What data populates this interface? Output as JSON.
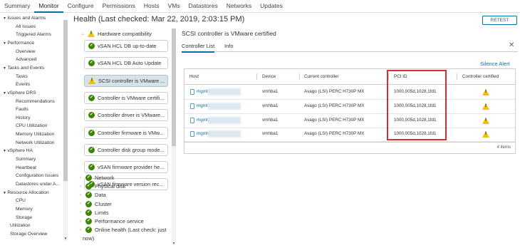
{
  "top_tabs": [
    "Summary",
    "Monitor",
    "Configure",
    "Permissions",
    "Hosts",
    "VMs",
    "Datastores",
    "Networks",
    "Updates"
  ],
  "active_tab": "Monitor",
  "sidebar": {
    "items": [
      {
        "label": "Issues and Alarms",
        "caret": "▼",
        "indent": 0
      },
      {
        "label": "All Issues",
        "caret": "",
        "indent": 1
      },
      {
        "label": "Triggered Alarms",
        "caret": "",
        "indent": 1
      },
      {
        "label": "Performance",
        "caret": "▼",
        "indent": 0
      },
      {
        "label": "Overview",
        "caret": "",
        "indent": 1
      },
      {
        "label": "Advanced",
        "caret": "",
        "indent": 1
      },
      {
        "label": "Tasks and Events",
        "caret": "▼",
        "indent": 0
      },
      {
        "label": "Tasks",
        "caret": "",
        "indent": 1
      },
      {
        "label": "Events",
        "caret": "",
        "indent": 1
      },
      {
        "label": "vSphere DRS",
        "caret": "▼",
        "indent": 0
      },
      {
        "label": "Recommendations",
        "caret": "",
        "indent": 1
      },
      {
        "label": "Faults",
        "caret": "",
        "indent": 1
      },
      {
        "label": "History",
        "caret": "",
        "indent": 1
      },
      {
        "label": "CPU Utilization",
        "caret": "",
        "indent": 1
      },
      {
        "label": "Memory Utilization",
        "caret": "",
        "indent": 1
      },
      {
        "label": "Network Utilization",
        "caret": "",
        "indent": 1
      },
      {
        "label": "vSphere HA",
        "caret": "▼",
        "indent": 0
      },
      {
        "label": "Summary",
        "caret": "",
        "indent": 1
      },
      {
        "label": "Heartbeat",
        "caret": "",
        "indent": 1
      },
      {
        "label": "Configuration Issues",
        "caret": "",
        "indent": 1
      },
      {
        "label": "Datastores under A...",
        "caret": "",
        "indent": 1
      },
      {
        "label": "Resource Allocation",
        "caret": "▼",
        "indent": 0
      },
      {
        "label": "CPU",
        "caret": "",
        "indent": 1
      },
      {
        "label": "Memory",
        "caret": "",
        "indent": 1
      },
      {
        "label": "Storage",
        "caret": "",
        "indent": 1
      },
      {
        "label": "Utilization",
        "caret": "",
        "indent": 0.5
      },
      {
        "label": "Storage Overview",
        "caret": "",
        "indent": 0.5
      }
    ]
  },
  "health": {
    "title": "Health (Last checked: Mar 22, 2019, 2:03:15 PM)",
    "retest_label": "RETEST",
    "hw_group": "Hardware compatibility",
    "checks": [
      {
        "label": "vSAN HCL DB up-to-date",
        "status": "ok"
      },
      {
        "label": "vSAN HCL DB Auto Update",
        "status": "ok"
      },
      {
        "label": "SCSI controller is VMware ...",
        "status": "warn"
      },
      {
        "label": "Controller is VMware certifi...",
        "status": "ok"
      },
      {
        "label": "Controller driver is VMware...",
        "status": "ok"
      },
      {
        "label": "Controller firmware is VMw...",
        "status": "ok"
      },
      {
        "label": "Controller disk group mode...",
        "status": "ok"
      },
      {
        "label": "vSAN firmware provider he...",
        "status": "ok"
      },
      {
        "label": "vSAN firmware version rec...",
        "status": "ok"
      }
    ],
    "groups": [
      "Network",
      "Physical disk",
      "Data",
      "Cluster",
      "Limits",
      "Performance service",
      "Online health (Last check: just"
    ],
    "groups_tail": "now)"
  },
  "detail": {
    "title": "SCSI controller is VMware certified",
    "tabs": [
      "Controller List",
      "Info"
    ],
    "silence_label": "Silence Alert",
    "columns": [
      "Host",
      "Device",
      "Current controller",
      "PCI ID",
      "Controller certified"
    ],
    "rows": [
      {
        "host": "mgmt3",
        "device": "vmhba1",
        "controller": "Avago (LSI) PERC H730P MX",
        "pci": "1000,005d,1028,1fd1"
      },
      {
        "host": "mgmt1",
        "device": "vmhba1",
        "controller": "Avago (LSI) PERC H730P MX",
        "pci": "1000,005d,1028,1fd1"
      },
      {
        "host": "mgmt2",
        "device": "vmhba1",
        "controller": "Avago (LSI) PERC H730P MX",
        "pci": "1000,005d,1028,1fd1"
      },
      {
        "host": "mgmt4",
        "device": "vmhba1",
        "controller": "Avago (LSI) PERC H730P MX",
        "pci": "1000,005d,1028,1fd1"
      }
    ],
    "items_count": "4 items"
  },
  "colors": {
    "accent": "#0072a3",
    "ok": "#3c8500",
    "warn": "#efc006",
    "highlight": "#d62d2d"
  }
}
